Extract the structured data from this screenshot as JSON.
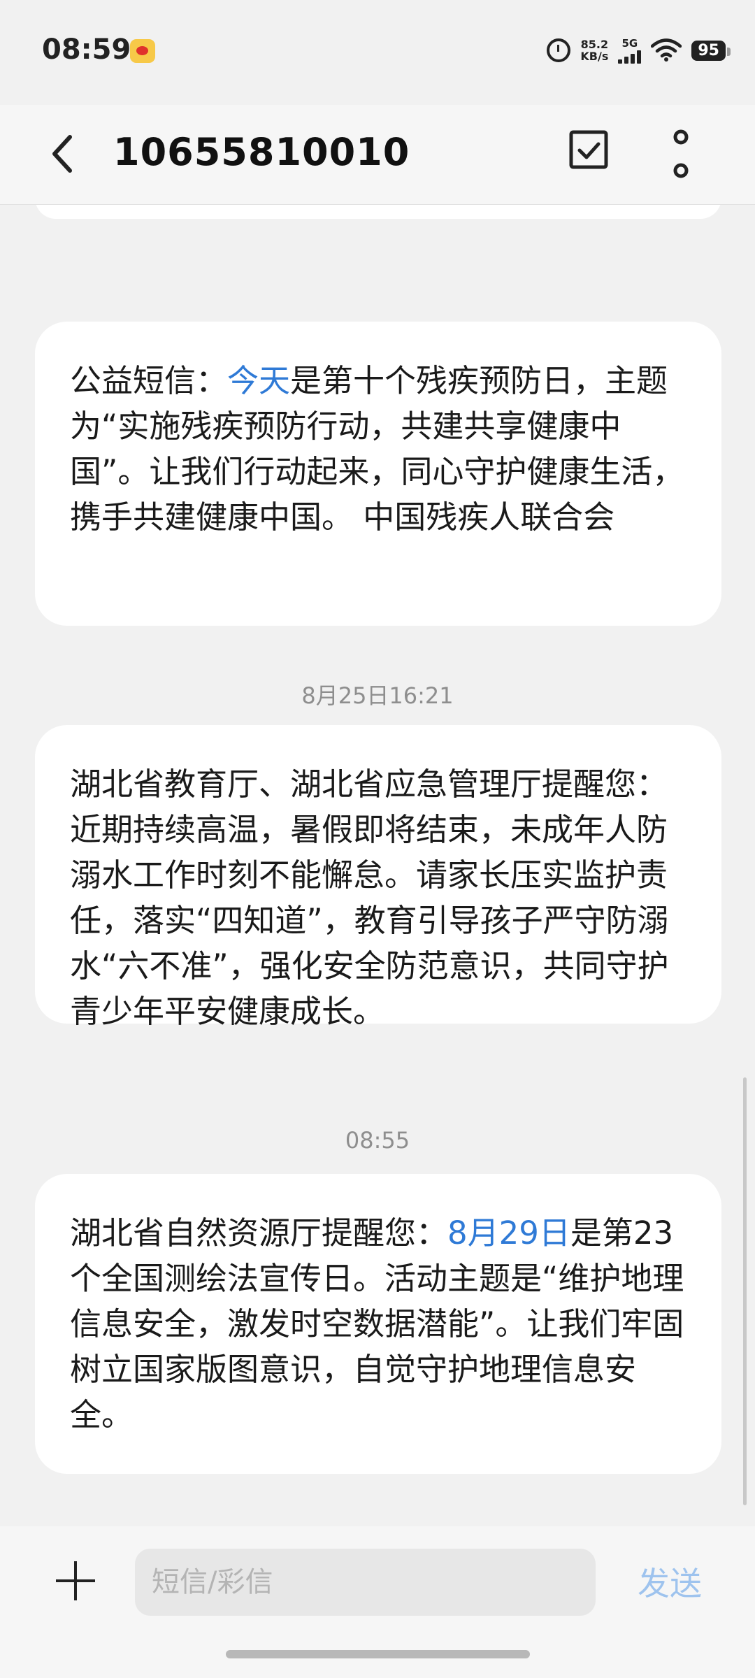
{
  "status_bar": {
    "time": "08:59",
    "net_speed_value": "85.2",
    "net_speed_unit": "KB/s",
    "network_type": "5G",
    "battery": "95",
    "icons": [
      "weibo-icon",
      "alarm-icon",
      "signal-icon",
      "wifi-icon",
      "battery-icon"
    ]
  },
  "header": {
    "title": "10655810010",
    "icons": [
      "back-arrow-icon",
      "select-checkbox-icon",
      "more-vertical-icon"
    ]
  },
  "messages": [
    {
      "timestamp": "",
      "segments": [
        {
          "text": "公益短信：",
          "highlight": false
        },
        {
          "text": "今天",
          "highlight": true
        },
        {
          "text": "是第十个残疾预防日，主题为“实施残疾预防行动，共建共享健康中国”。让我们行动起来，同心守护健康生活，携手共建健康中国。 中国残疾人联合会",
          "highlight": false
        }
      ]
    },
    {
      "timestamp": "8月25日16:21",
      "segments": [
        {
          "text": "湖北省教育厅、湖北省应急管理厅提醒您：近期持续高温，暑假即将结束，未成年人防溺水工作时刻不能懈怠。请家长压实监护责任，落实“四知道”，教育引导孩子严守防溺水“六不准”，强化安全防范意识，共同守护青少年平安健康成长。",
          "highlight": false
        }
      ]
    },
    {
      "timestamp": "08:55",
      "segments": [
        {
          "text": "湖北省自然资源厅提醒您：",
          "highlight": false
        },
        {
          "text": "8月29日",
          "highlight": true
        },
        {
          "text": "是第23个全国测绘法宣传日。活动主题是“维护地理信息安全，激发时空数据潜能”。让我们牢固树立国家版图意识，自觉守护地理信息安全。",
          "highlight": false
        }
      ]
    }
  ],
  "composer": {
    "placeholder": "短信/彩信",
    "send_label": "发送",
    "add_icon": "plus-icon"
  },
  "colors": {
    "background": "#f1f1f1",
    "bubble": "#ffffff",
    "link": "#2f7ad6",
    "send_disabled": "#9ec3ee"
  }
}
